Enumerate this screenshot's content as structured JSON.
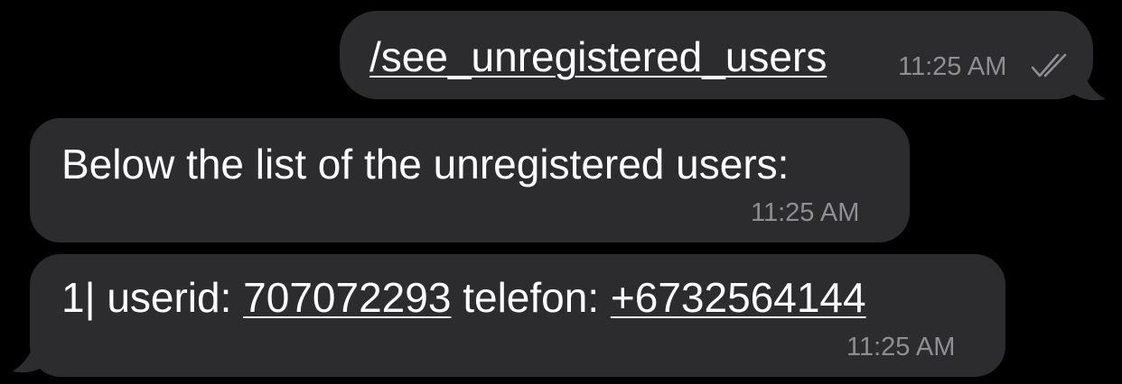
{
  "messages": {
    "outgoing": {
      "command": "/see_unregistered_users",
      "time": "11:25 AM",
      "status_icon": "double-check-read-icon"
    },
    "incoming_1": {
      "text": "Below the list of the unregistered users:",
      "time": "11:25 AM"
    },
    "incoming_2": {
      "prefix": "1| userid: ",
      "userid": "707072293",
      "phone_label": " telefon: ",
      "phone": "+6732564144",
      "time": "11:25 AM"
    }
  },
  "colors": {
    "background": "#000000",
    "bubble": "#2c2c2e",
    "text": "#ffffff",
    "timestamp": "#8e8e93"
  }
}
